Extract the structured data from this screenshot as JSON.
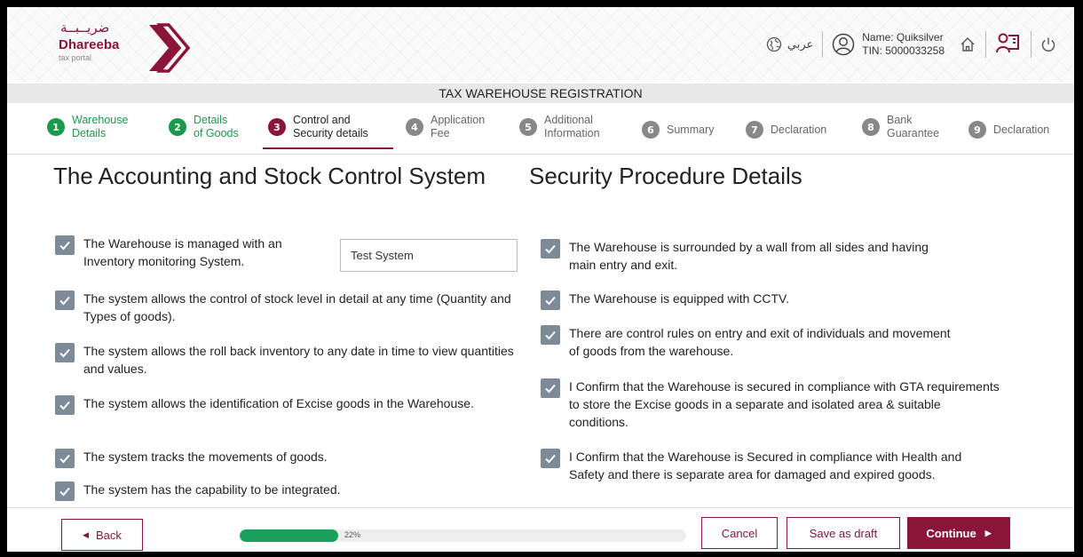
{
  "header": {
    "logo_ar": "ضريــبــة",
    "logo_en": "Dhareeba",
    "logo_sub": "tax portal",
    "language_label": "عربي",
    "user_name": "Name: Quiksilver",
    "user_tin": "TIN: 5000033258",
    "accent": "#8a1538"
  },
  "page_title": "TAX WAREHOUSE REGISTRATION",
  "steps": [
    {
      "num": "1",
      "line1": "Warehouse",
      "line2": "Details",
      "state": "done"
    },
    {
      "num": "2",
      "line1": "Details",
      "line2": "of Goods",
      "state": "done"
    },
    {
      "num": "3",
      "line1": "Control and",
      "line2": "Security details",
      "state": "active"
    },
    {
      "num": "4",
      "line1": "Application",
      "line2": "Fee",
      "state": "todo"
    },
    {
      "num": "5",
      "line1": "Additional",
      "line2": "Information",
      "state": "todo"
    },
    {
      "num": "6",
      "line1": "Summary",
      "line2": "",
      "state": "todo"
    },
    {
      "num": "7",
      "line1": "Declaration",
      "line2": "",
      "state": "todo"
    },
    {
      "num": "8",
      "line1": "Bank",
      "line2": "Guarantee",
      "state": "todo"
    },
    {
      "num": "9",
      "line1": "Declaration",
      "line2": "",
      "state": "todo"
    }
  ],
  "left": {
    "heading": "The Accounting and Stock Control System",
    "system_name_value": "Test System",
    "items": [
      {
        "text": "The Warehouse is managed with an Inventory monitoring System.",
        "checked": true
      },
      {
        "text": "The system allows the control of stock level in detail at any time (Quantity and Types of goods).",
        "checked": true
      },
      {
        "text": "The system allows the roll back inventory to any date in time to view quantities and values.",
        "checked": true
      },
      {
        "text": "The system allows the identification of Excise goods in the Warehouse.",
        "checked": true
      },
      {
        "text": "The system tracks the movements of goods.",
        "checked": true
      },
      {
        "text": "The system has the capability to be integrated.",
        "checked": true
      }
    ]
  },
  "right": {
    "heading": "Security Procedure Details",
    "items": [
      {
        "text": "The Warehouse is surrounded by a wall from all sides and having main entry and exit.",
        "checked": true
      },
      {
        "text": "The Warehouse is equipped with CCTV.",
        "checked": true
      },
      {
        "text": "There are control rules on entry and exit of individuals and movement of goods from the warehouse.",
        "checked": true
      },
      {
        "text": "I Confirm that the Warehouse is secured in compliance with GTA requirements to store the Excise goods in a separate and isolated area & suitable conditions.",
        "checked": true
      },
      {
        "text": "I Confirm that the Warehouse is Secured in compliance with Health and Safety and there is separate area for damaged and expired goods.",
        "checked": true
      }
    ]
  },
  "footer": {
    "back_label": "Back",
    "progress_label": "22%",
    "progress_fraction": 0.22,
    "cancel_label": "Cancel",
    "save_label": "Save as draft",
    "continue_label": "Continue"
  }
}
